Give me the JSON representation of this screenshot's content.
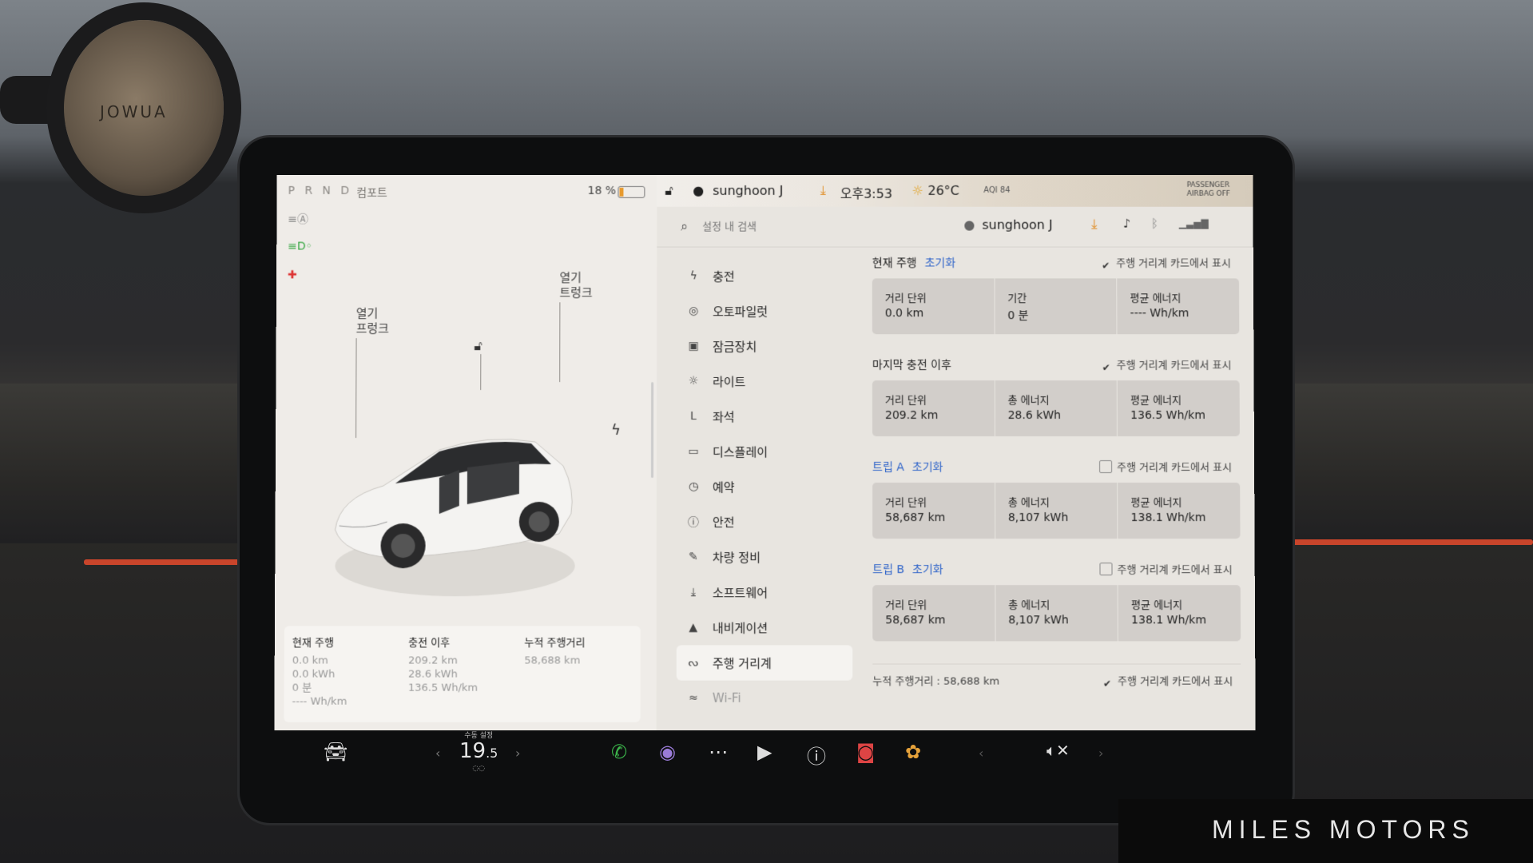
{
  "mount": {
    "brand": "JOWUA"
  },
  "watermark": {
    "text": "MILES MOTORS"
  },
  "status_left": {
    "gears": [
      "P",
      "R",
      "N",
      "D"
    ],
    "drive_mode": "컴포트",
    "battery_percent": "18 %",
    "battery_level": 0.18
  },
  "car_view": {
    "frunk": {
      "line1": "열기",
      "line2": "프렁크"
    },
    "trunk": {
      "line1": "열기",
      "line2": "트렁크"
    }
  },
  "left_stats": {
    "current": {
      "title": "현재 주행",
      "lines": [
        "0.0 km",
        "0.0 kWh",
        "0 분",
        "---- Wh/km"
      ]
    },
    "since_charge": {
      "title": "충전 이후",
      "lines": [
        "209.2 km",
        "28.6 kWh",
        "136.5 Wh/km"
      ]
    },
    "odometer": {
      "title": "누적 주행거리",
      "lines": [
        "58,688 km"
      ]
    }
  },
  "top_bar": {
    "user": "sunghoon J",
    "time": "오후3:53",
    "weather": "26°C",
    "aqi": "AQI 84",
    "airbag": "PASSENGER AIRBAG OFF"
  },
  "search": {
    "placeholder": "설정 내 검색",
    "user": "sunghoon J"
  },
  "menu": [
    {
      "label": "충전",
      "icon": "bolt-icon",
      "glyph": "ϟ"
    },
    {
      "label": "오토파일럿",
      "icon": "steering-wheel-icon",
      "glyph": "◎"
    },
    {
      "label": "잠금장치",
      "icon": "lock-icon",
      "glyph": "▣"
    },
    {
      "label": "라이트",
      "icon": "sun-icon",
      "glyph": "☼"
    },
    {
      "label": "좌석",
      "icon": "seat-icon",
      "glyph": "ᒪ"
    },
    {
      "label": "디스플레이",
      "icon": "display-icon",
      "glyph": "▭"
    },
    {
      "label": "예약",
      "icon": "alarm-icon",
      "glyph": "◷"
    },
    {
      "label": "안전",
      "icon": "alert-icon",
      "glyph": "ⓘ"
    },
    {
      "label": "차량 정비",
      "icon": "wrench-icon",
      "glyph": "✎"
    },
    {
      "label": "소프트웨어",
      "icon": "download-icon",
      "glyph": "⤓"
    },
    {
      "label": "내비게이션",
      "icon": "navigation-icon",
      "glyph": "▲"
    },
    {
      "label": "주행 거리계",
      "icon": "trips-icon",
      "glyph": "ᔓ"
    },
    {
      "label": "Wi-Fi",
      "icon": "wifi-icon",
      "glyph": "≈"
    }
  ],
  "sections": [
    {
      "title": "현재 주행",
      "reset": "초기화",
      "checked": true,
      "blue": false,
      "check_label": "주행 거리계 카드에서 표시",
      "cells": [
        {
          "label": "거리 단위",
          "value": "0.0 km"
        },
        {
          "label": "기간",
          "value": "0 분"
        },
        {
          "label": "평균 에너지",
          "value": "---- Wh/km"
        }
      ]
    },
    {
      "title": "마지막 충전 이후",
      "reset": "",
      "checked": true,
      "blue": false,
      "check_label": "주행 거리계 카드에서 표시",
      "cells": [
        {
          "label": "거리 단위",
          "value": "209.2 km"
        },
        {
          "label": "총 에너지",
          "value": "28.6 kWh"
        },
        {
          "label": "평균 에너지",
          "value": "136.5 Wh/km"
        }
      ]
    },
    {
      "title": "트립 A",
      "reset": "초기화",
      "checked": false,
      "blue": true,
      "check_label": "주행 거리계 카드에서 표시",
      "cells": [
        {
          "label": "거리 단위",
          "value": "58,687 km"
        },
        {
          "label": "총 에너지",
          "value": "8,107 kWh"
        },
        {
          "label": "평균 에너지",
          "value": "138.1 Wh/km"
        }
      ]
    },
    {
      "title": "트립 B",
      "reset": "초기화",
      "checked": false,
      "blue": true,
      "check_label": "주행 거리계 카드에서 표시",
      "cells": [
        {
          "label": "거리 단위",
          "value": "58,687 km"
        },
        {
          "label": "총 에너지",
          "value": "8,107 kWh"
        },
        {
          "label": "평균 에너지",
          "value": "138.1 Wh/km"
        }
      ]
    }
  ],
  "odometer_row": {
    "label": "누적 주행거리 : 58,688 km",
    "check_label": "주행 거리계 카드에서 표시",
    "checked": true
  },
  "dock": {
    "temp_label": "수동 설정",
    "temp_value": "19",
    "temp_decimal": ".5"
  }
}
